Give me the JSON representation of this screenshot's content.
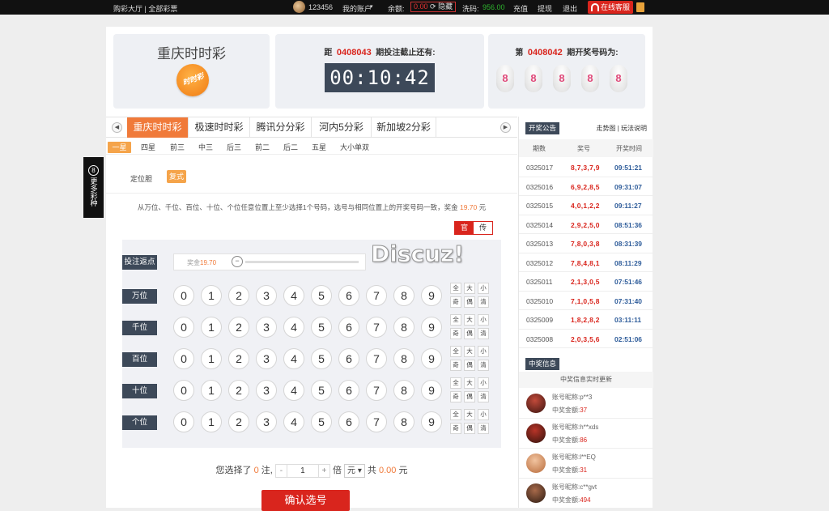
{
  "topbar": {
    "nav": "购彩大厅 | 全部彩票",
    "username": "123456",
    "my_account": "我的账户",
    "balance_label": "余额:",
    "balance_value": "0.00",
    "hide": "隐藏",
    "wash_label": "洗码:",
    "wash_value": "956.00",
    "recharge": "充值",
    "withdraw": "提现",
    "logout": "退出",
    "service": "在线客服"
  },
  "game": {
    "name": "重庆时时彩",
    "logo_text": "时时彩"
  },
  "countdown": {
    "prefix": "距",
    "issue": "0408043",
    "suffix": "期投注截止还有:",
    "time": "00:10:42"
  },
  "last_draw": {
    "prefix": "第",
    "issue": "0408042",
    "suffix": "期开奖号码为:",
    "balls": [
      "8",
      "8",
      "8",
      "8",
      "8"
    ]
  },
  "tabs": [
    "重庆时时彩",
    "极速时时彩",
    "腾讯分分彩",
    "河内5分彩",
    "新加坡2分彩"
  ],
  "subtabs": [
    "一星",
    "四星",
    "前三",
    "中三",
    "后三",
    "前二",
    "后二",
    "五星",
    "大小单双"
  ],
  "position": {
    "label": "定位胆",
    "mode": "复式"
  },
  "description": {
    "text": "从万位、千位、百位、十位、个位任意位置上至少选择1个号码，选号与相同位置上的开奖号码一致，奖金",
    "amount": "19.70",
    "unit": "元"
  },
  "bet_toggle": [
    "官",
    "传"
  ],
  "rebate": {
    "label": "投注返点",
    "prefix": "奖金",
    "value": "19.70",
    "knob": "−"
  },
  "rows": [
    {
      "label": "万位"
    },
    {
      "label": "千位"
    },
    {
      "label": "百位"
    },
    {
      "label": "十位"
    },
    {
      "label": "个位"
    }
  ],
  "digits": [
    "0",
    "1",
    "2",
    "3",
    "4",
    "5",
    "6",
    "7",
    "8",
    "9"
  ],
  "quick": [
    "全",
    "大",
    "小",
    "奇",
    "偶",
    "清"
  ],
  "summary": {
    "selected_prefix": "您选择了",
    "selected_count": "0",
    "selected_suffix": "注,",
    "minus": "-",
    "multiplier": "1",
    "plus": "+",
    "times": "倍",
    "unit": "元",
    "total_prefix": "共",
    "total": "0.00",
    "total_unit": "元"
  },
  "confirm": "确认选号",
  "announce": {
    "tag": "开奖公告",
    "links": "走势图 | 玩法说明",
    "headers": [
      "期数",
      "奖号",
      "开奖时间"
    ],
    "rows": [
      {
        "issue": "0325017",
        "nums": "8,7,3,7,9",
        "time": "09:51:21"
      },
      {
        "issue": "0325016",
        "nums": "6,9,2,8,5",
        "time": "09:31:07"
      },
      {
        "issue": "0325015",
        "nums": "4,0,1,2,2",
        "time": "09:11:27"
      },
      {
        "issue": "0325014",
        "nums": "2,9,2,5,0",
        "time": "08:51:36"
      },
      {
        "issue": "0325013",
        "nums": "7,8,0,3,8",
        "time": "08:31:39"
      },
      {
        "issue": "0325012",
        "nums": "7,8,4,8,1",
        "time": "08:11:29"
      },
      {
        "issue": "0325011",
        "nums": "2,1,3,0,5",
        "time": "07:51:46"
      },
      {
        "issue": "0325010",
        "nums": "7,1,0,5,8",
        "time": "07:31:40"
      },
      {
        "issue": "0325009",
        "nums": "1,8,2,8,2",
        "time": "03:11:11"
      },
      {
        "issue": "0325008",
        "nums": "2,0,3,5,6",
        "time": "02:51:06"
      }
    ]
  },
  "wins": {
    "tag": "中奖信息",
    "title": "中奖信息实时更新",
    "nick_label": "账号昵称:",
    "amount_label": "中奖金额:",
    "items": [
      {
        "nick": "p**3",
        "amount": "37"
      },
      {
        "nick": "h**xds",
        "amount": "86"
      },
      {
        "nick": "l**EQ",
        "amount": "31"
      },
      {
        "nick": "c**gvt",
        "amount": "494"
      }
    ]
  },
  "float": {
    "icon": "8",
    "text": "更多彩种"
  },
  "watermark": "Discuz!"
}
